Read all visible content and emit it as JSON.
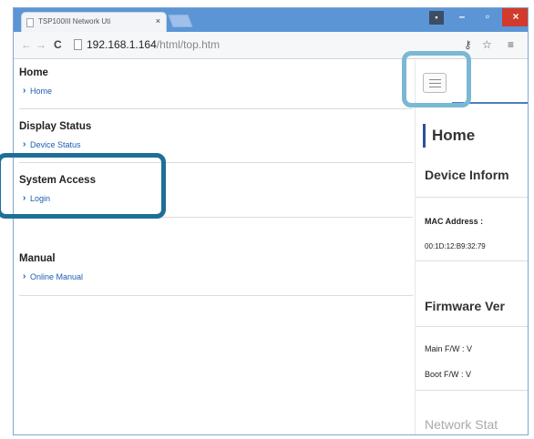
{
  "browser": {
    "tab_title": "TSP100III Network Uti",
    "tab_close": "×",
    "url_host": "192.168.1.164",
    "url_path": "/html/top.htm",
    "window_controls": {
      "user": "▪",
      "minimize": "–",
      "maximize": "▫",
      "close": "×"
    },
    "nav": {
      "back": "←",
      "forward": "→",
      "reload": "C"
    },
    "toolbar_right": {
      "key": "⚷",
      "star": "☆",
      "menu": "≡"
    }
  },
  "sidebar": {
    "sections": [
      {
        "title": "Home",
        "link": "Home"
      },
      {
        "title": "Display Status",
        "link": "Device Status"
      },
      {
        "title": "System Access",
        "link": "Login"
      },
      {
        "title": "Manual",
        "link": "Online Manual"
      }
    ]
  },
  "main": {
    "page_title": "Home",
    "device_info_heading": "Device Inform",
    "mac_label": "MAC Address :",
    "mac_value": "00:1D:12:B9:32:79",
    "firmware_heading": "Firmware Ver",
    "main_fw": "Main F/W : V",
    "boot_fw": "Boot F/W : V",
    "network_heading": "Network Stat"
  },
  "colors": {
    "titlebar": "#5b95d6",
    "link": "#1b5fb3",
    "highlight": "#1d6f98",
    "highlight_light": "#7ab8d3"
  }
}
